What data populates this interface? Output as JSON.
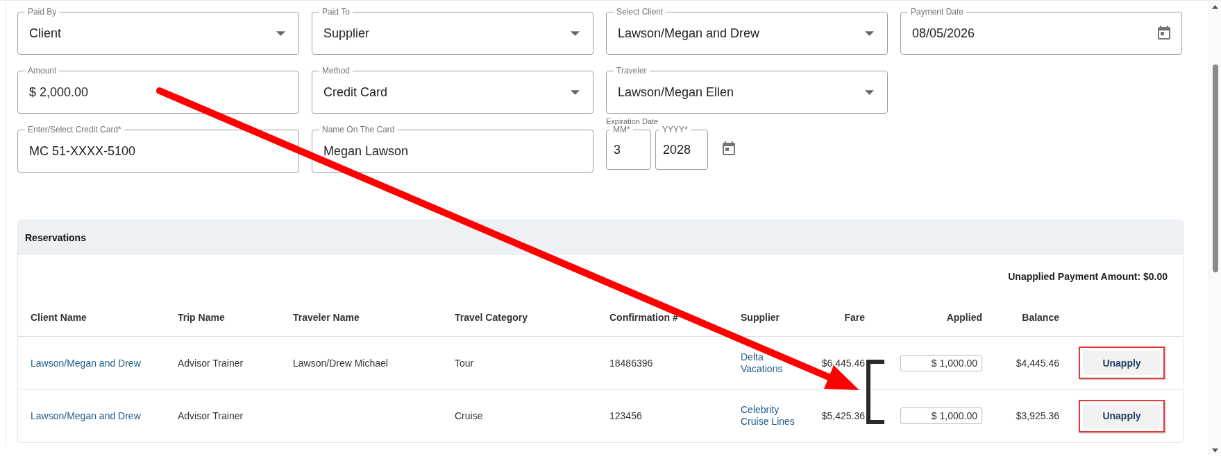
{
  "form_rows": [
    [
      {
        "label": "Paid By",
        "value": "Client",
        "kind": "select"
      },
      {
        "label": "Paid To",
        "value": "Supplier",
        "kind": "select"
      },
      {
        "label": "Select Client",
        "value": "Lawson/Megan and Drew",
        "kind": "select"
      },
      {
        "label": "Payment Date",
        "value": "08/05/2026",
        "kind": "date"
      }
    ],
    [
      {
        "label": "Amount",
        "value": "$ 2,000.00",
        "kind": "text"
      },
      {
        "label": "Method",
        "value": "Credit Card",
        "kind": "select"
      },
      {
        "label": "Traveler",
        "value": "Lawson/Megan Ellen",
        "kind": "select"
      }
    ],
    [
      {
        "label": "Enter/Select Credit Card*",
        "value": "MC 51-XXXX-5100",
        "kind": "text"
      },
      {
        "label": "Name On The Card",
        "value": "Megan Lawson",
        "kind": "text"
      },
      {
        "label": "Expiration Date",
        "kind": "expiry",
        "month_label": "MM*",
        "month": "3",
        "year_label": "YYYY*",
        "year": "2028"
      }
    ]
  ],
  "reservations": {
    "title": "Reservations",
    "unapplied": "Unapplied Payment Amount: $0.00",
    "columns": [
      "Client Name",
      "Trip Name",
      "Traveler Name",
      "Travel Category",
      "Confirmation #",
      "Supplier",
      "Fare",
      "Applied",
      "Balance"
    ],
    "rows": [
      {
        "client": "Lawson/Megan and Drew",
        "trip": "Advisor Trainer",
        "traveler": "Lawson/Drew Michael",
        "category": "Tour",
        "confirmation": "18486396",
        "supplier": [
          "Delta",
          "Vacations"
        ],
        "fare": "$6,445.46",
        "applied": "$ 1,000.00",
        "balance": "$4,445.46",
        "button": "Unapply",
        "highlighted": true
      },
      {
        "client": "Lawson/Megan and Drew",
        "trip": "Advisor Trainer",
        "traveler": "",
        "category": "Cruise",
        "confirmation": "123456",
        "supplier": [
          "Celebrity",
          "Cruise Lines"
        ],
        "fare": "$5,425.36",
        "applied": "$ 1,000.00",
        "balance": "$3,925.36",
        "button": "Unapply",
        "highlighted": true
      }
    ]
  }
}
